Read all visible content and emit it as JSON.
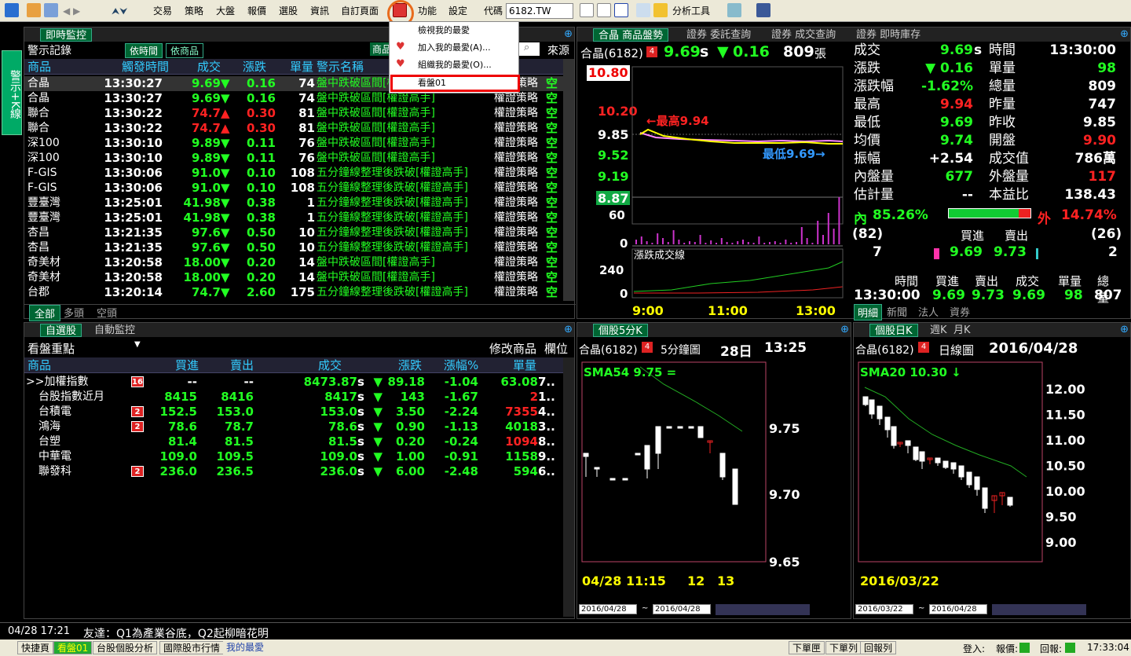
{
  "toolbar": {
    "menus": [
      "交易",
      "策略",
      "大盤",
      "報價",
      "選股",
      "資訊",
      "自訂頁面",
      "功能",
      "設定"
    ],
    "code_label": "代碼",
    "code_value": "6182.TW",
    "analysis": "分析工具"
  },
  "fav_menu": {
    "items": [
      "檢視我的最愛",
      "加入我的最愛(A)...",
      "組織我的最愛(O)...",
      "看盤01"
    ]
  },
  "side_tab": "警示+K線",
  "monitor": {
    "title": "即時監控",
    "tab1": "依時間",
    "tab2": "依商品",
    "sub": "警示記錄",
    "right": "來源",
    "mini_btn": "商品",
    "headers": [
      "商品",
      "觸發時間",
      "成交",
      "漲跌",
      "單量",
      "警示名稱"
    ],
    "rows": [
      {
        "name": "合晶",
        "time": "13:30:27",
        "price": "9.69",
        "arrow": "▼",
        "chg": "0.16",
        "qty": "74",
        "alert": "盤中跌破區間[權證高手]",
        "src": "權證策略",
        "tag": "空",
        "up": false
      },
      {
        "name": "合晶",
        "time": "13:30:27",
        "price": "9.69",
        "arrow": "▼",
        "chg": "0.16",
        "qty": "74",
        "alert": "盤中跌破區間[權證高手]",
        "src": "權證策略",
        "tag": "空",
        "up": false
      },
      {
        "name": "聯合",
        "time": "13:30:22",
        "price": "74.7",
        "arrow": "▲",
        "chg": "0.30",
        "qty": "81",
        "alert": "盤中跌破區間[權證高手]",
        "src": "權證策略",
        "tag": "空",
        "up": true
      },
      {
        "name": "聯合",
        "time": "13:30:22",
        "price": "74.7",
        "arrow": "▲",
        "chg": "0.30",
        "qty": "81",
        "alert": "盤中跌破區間[權證高手]",
        "src": "權證策略",
        "tag": "空",
        "up": true
      },
      {
        "name": "深100",
        "time": "13:30:10",
        "price": "9.89",
        "arrow": "▼",
        "chg": "0.11",
        "qty": "76",
        "alert": "盤中跌破區間[權證高手]",
        "src": "權證策略",
        "tag": "空",
        "up": false
      },
      {
        "name": "深100",
        "time": "13:30:10",
        "price": "9.89",
        "arrow": "▼",
        "chg": "0.11",
        "qty": "76",
        "alert": "盤中跌破區間[權證高手]",
        "src": "權證策略",
        "tag": "空",
        "up": false
      },
      {
        "name": "F-GIS",
        "time": "13:30:06",
        "price": "91.0",
        "arrow": "▼",
        "chg": "0.10",
        "qty": "108",
        "alert": "五分鐘線整理後跌破[權證高手]",
        "src": "權證策略",
        "tag": "空",
        "up": false
      },
      {
        "name": "F-GIS",
        "time": "13:30:06",
        "price": "91.0",
        "arrow": "▼",
        "chg": "0.10",
        "qty": "108",
        "alert": "五分鐘線整理後跌破[權證高手]",
        "src": "權證策略",
        "tag": "空",
        "up": false
      },
      {
        "name": "豐臺灣",
        "time": "13:25:01",
        "price": "41.98",
        "arrow": "▼",
        "chg": "0.38",
        "qty": "1",
        "alert": "五分鐘線整理後跌破[權證高手]",
        "src": "權證策略",
        "tag": "空",
        "up": false
      },
      {
        "name": "豐臺灣",
        "time": "13:25:01",
        "price": "41.98",
        "arrow": "▼",
        "chg": "0.38",
        "qty": "1",
        "alert": "五分鐘線整理後跌破[權證高手]",
        "src": "權證策略",
        "tag": "空",
        "up": false
      },
      {
        "name": "杏昌",
        "time": "13:21:35",
        "price": "97.6",
        "arrow": "▼",
        "chg": "0.50",
        "qty": "10",
        "alert": "五分鐘線整理後跌破[權證高手]",
        "src": "權證策略",
        "tag": "空",
        "up": false
      },
      {
        "name": "杏昌",
        "time": "13:21:35",
        "price": "97.6",
        "arrow": "▼",
        "chg": "0.50",
        "qty": "10",
        "alert": "五分鐘線整理後跌破[權證高手]",
        "src": "權證策略",
        "tag": "空",
        "up": false
      },
      {
        "name": "奇美材",
        "time": "13:20:58",
        "price": "18.00",
        "arrow": "▼",
        "chg": "0.20",
        "qty": "14",
        "alert": "盤中跌破區間[權證高手]",
        "src": "權證策略",
        "tag": "空",
        "up": false
      },
      {
        "name": "奇美材",
        "time": "13:20:58",
        "price": "18.00",
        "arrow": "▼",
        "chg": "0.20",
        "qty": "14",
        "alert": "盤中跌破區間[權證高手]",
        "src": "權證策略",
        "tag": "空",
        "up": false
      },
      {
        "name": "台郡",
        "time": "13:20:14",
        "price": "74.7",
        "arrow": "▼",
        "chg": "2.60",
        "qty": "175",
        "alert": "五分鐘線整理後跌破[權證高手]",
        "src": "權證策略",
        "tag": "空",
        "up": false
      }
    ],
    "bottom_tabs": [
      "全部",
      "多頭",
      "空頭"
    ]
  },
  "quote": {
    "tabs": [
      "合晶 商品盤勢",
      "證券 委託查詢",
      "證券 成交查詢",
      "證券 即時庫存"
    ],
    "name": "合晶(6182)",
    "badge": "4",
    "price": "9.69",
    "s": "s",
    "arrow": "▼",
    "chg": "0.16",
    "vol": "809",
    "vol_unit": "張",
    "high_label": "←最高9.94",
    "low_label": "最低9.69→",
    "ylabels": [
      "10.80",
      "10.20",
      "9.85",
      "9.52",
      "9.19",
      "8.87"
    ],
    "vol_axis": [
      "60",
      "0"
    ],
    "line_label": "漲跌成交線",
    "line_axis": [
      "240",
      "0"
    ],
    "x_axis": [
      "9:00",
      "11:00",
      "13:00"
    ],
    "stats": [
      [
        "成交",
        "9.69",
        "s",
        "時間",
        "13:30:00"
      ],
      [
        "漲跌",
        "▼ 0.16",
        "",
        "單量",
        "98"
      ],
      [
        "漲跌幅",
        "-1.62%",
        "",
        "總量",
        "809"
      ],
      [
        "最高",
        "9.94",
        "",
        "昨量",
        "747"
      ],
      [
        "最低",
        "9.69",
        "",
        "昨收",
        "9.85"
      ],
      [
        "均價",
        "9.74",
        "",
        "開盤",
        "9.90"
      ],
      [
        "振幅",
        "+2.54",
        "",
        "成交值",
        "786萬"
      ],
      [
        "內盤量",
        "677",
        "",
        "外盤量",
        "117"
      ],
      [
        "估計量",
        "--",
        "",
        "本益比",
        "138.43"
      ]
    ],
    "inner_pct_label": "內",
    "inner_pct": "85.26%",
    "outer_pct_label": "外",
    "outer_pct": "14.74%",
    "bid_cnt": "(82)",
    "ask_cnt": "(26)",
    "bid_hdr": "買進",
    "ask_hdr": "賣出",
    "bid_qty": "7",
    "bid": "9.69",
    "ask": "9.73",
    "ask_qty": "2",
    "tick_headers": [
      "時間",
      "買進",
      "賣出",
      "成交",
      "單量",
      "總量"
    ],
    "tick_row": [
      "13:30:00",
      "9.69",
      "9.73",
      "9.69",
      "98",
      "807"
    ],
    "bottom_tabs": [
      "明細",
      "新聞",
      "法人",
      "資券"
    ]
  },
  "watch": {
    "tabs": [
      "自選股",
      "自動監控"
    ],
    "group": "看盤重點",
    "edit": "修改商品",
    "col": "欄位",
    "headers": [
      "商品",
      "買進",
      "賣出",
      "成交",
      "漲跌",
      "漲幅%",
      "單量"
    ],
    "rows": [
      {
        "name": ">>加權指數",
        "badge": "16",
        "bid": "--",
        "ask": "--",
        "price": "8473.87",
        "s": "s",
        "arrow": "▼",
        "chg": "89.18",
        "pct": "-1.04",
        "qty": "63.08",
        "tail": "7.."
      },
      {
        "name": "台股指數近月",
        "badge": "",
        "bid": "8415",
        "ask": "8416",
        "price": "8417",
        "s": "s",
        "arrow": "▼",
        "chg": "143",
        "pct": "-1.67",
        "qty": "2",
        "tail": "1.."
      },
      {
        "name": "台積電",
        "badge": "2",
        "bid": "152.5",
        "ask": "153.0",
        "price": "153.0",
        "s": "s",
        "arrow": "▼",
        "chg": "3.50",
        "pct": "-2.24",
        "qty": "7355",
        "tail": "4.."
      },
      {
        "name": "鴻海",
        "badge": "2",
        "bid": "78.6",
        "ask": "78.7",
        "price": "78.6",
        "s": "s",
        "arrow": "▼",
        "chg": "0.90",
        "pct": "-1.13",
        "qty": "4018",
        "tail": "3.."
      },
      {
        "name": "台塑",
        "badge": "",
        "bid": "81.4",
        "ask": "81.5",
        "price": "81.5",
        "s": "s",
        "arrow": "▼",
        "chg": "0.20",
        "pct": "-0.24",
        "qty": "1094",
        "tail": "8.."
      },
      {
        "name": "中華電",
        "badge": "",
        "bid": "109.0",
        "ask": "109.5",
        "price": "109.0",
        "s": "s",
        "arrow": "▼",
        "chg": "1.00",
        "pct": "-0.91",
        "qty": "1158",
        "tail": "9.."
      },
      {
        "name": "聯發科",
        "badge": "2",
        "bid": "236.0",
        "ask": "236.5",
        "price": "236.0",
        "s": "s",
        "arrow": "▼",
        "chg": "6.00",
        "pct": "-2.48",
        "qty": "594",
        "tail": "6.."
      }
    ]
  },
  "k5": {
    "tab": "個股5分K",
    "name": "合晶(6182)",
    "badge": "4",
    "period": "5分鐘圖",
    "day": "28日",
    "time": "13:25",
    "sma": "SMA54 9.75 =",
    "ylabels": [
      "9.75",
      "9.70",
      "9.65"
    ],
    "x": [
      "04/28 11:15",
      "12",
      "13"
    ],
    "from": "2016/04/28",
    "to": "2016/04/28"
  },
  "kd": {
    "tabs": [
      "個股日K",
      "週K",
      "月K"
    ],
    "name": "合晶(6182)",
    "badge": "4",
    "period": "日線圖",
    "date": "2016/04/28",
    "sma": "SMA20 10.30 ↓",
    "ylabels": [
      "12.00",
      "11.50",
      "11.00",
      "10.50",
      "10.00",
      "9.50",
      "9.00"
    ],
    "x": "2016/03/22",
    "from": "2016/03/22",
    "to": "2016/04/28"
  },
  "status": {
    "time": "04/28 17:21",
    "msg": "友達：Q1為產業谷底，Q2起柳暗花明"
  },
  "taskbar": {
    "items": [
      "快捷頁",
      "看盤01",
      "台股個股分析",
      "國際股市行情",
      "我的最愛"
    ],
    "right": [
      "下單匣",
      "下單列",
      "回報列"
    ],
    "login": "登入:",
    "quote": "報價:",
    "report": "回報:",
    "clock": "17:33:04"
  }
}
